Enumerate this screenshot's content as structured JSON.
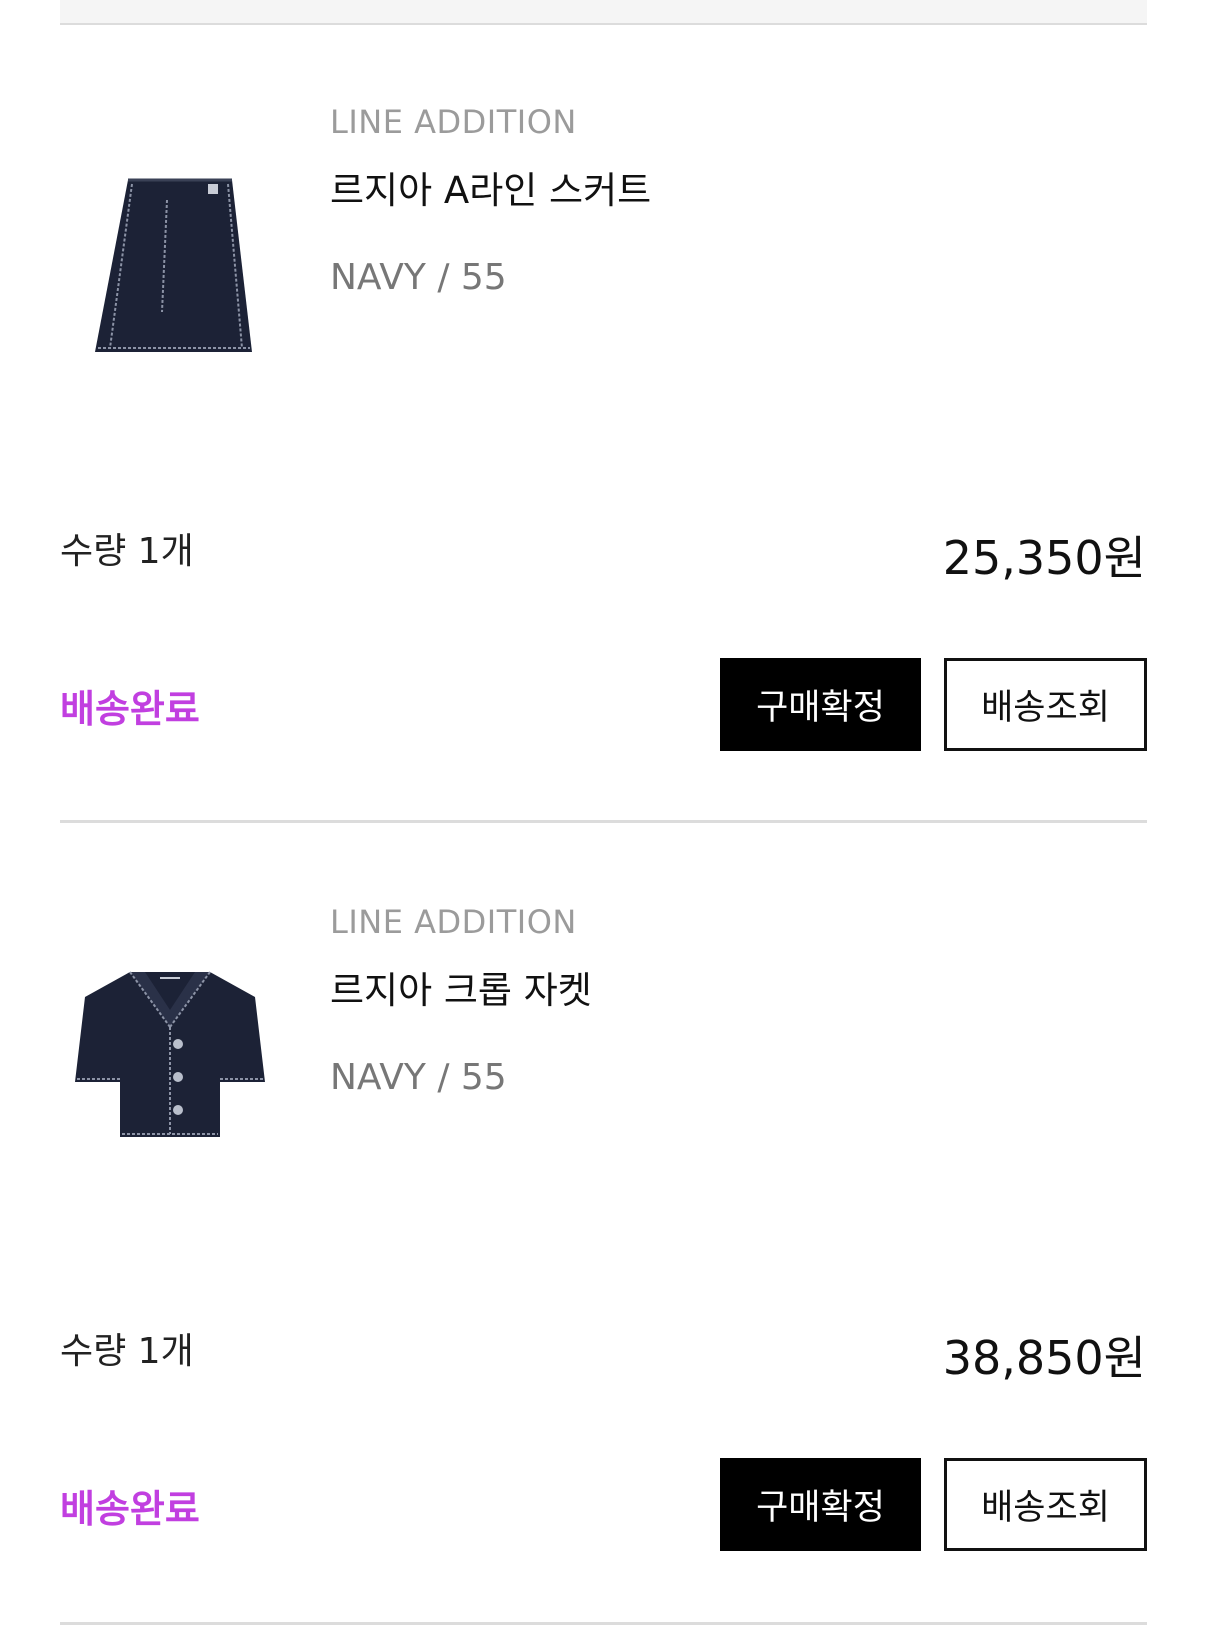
{
  "theme": {
    "status_color": "#c13fe0",
    "primary_button_bg": "#000000",
    "primary_button_fg": "#ffffff"
  },
  "orders": [
    {
      "image_icon": "navy-skirt-product-image",
      "brand": "LINE ADDITION",
      "name": "르지아 A라인 스커트",
      "option": "NAVY / 55",
      "quantity": "수량 1개",
      "price": "25,350원",
      "status": "배송완료",
      "confirm_label": "구매확정",
      "track_label": "배송조회"
    },
    {
      "image_icon": "navy-jacket-product-image",
      "brand": "LINE ADDITION",
      "name": "르지아 크롭 자켓",
      "option": "NAVY / 55",
      "quantity": "수량 1개",
      "price": "38,850원",
      "status": "배송완료",
      "confirm_label": "구매확정",
      "track_label": "배송조회"
    }
  ]
}
